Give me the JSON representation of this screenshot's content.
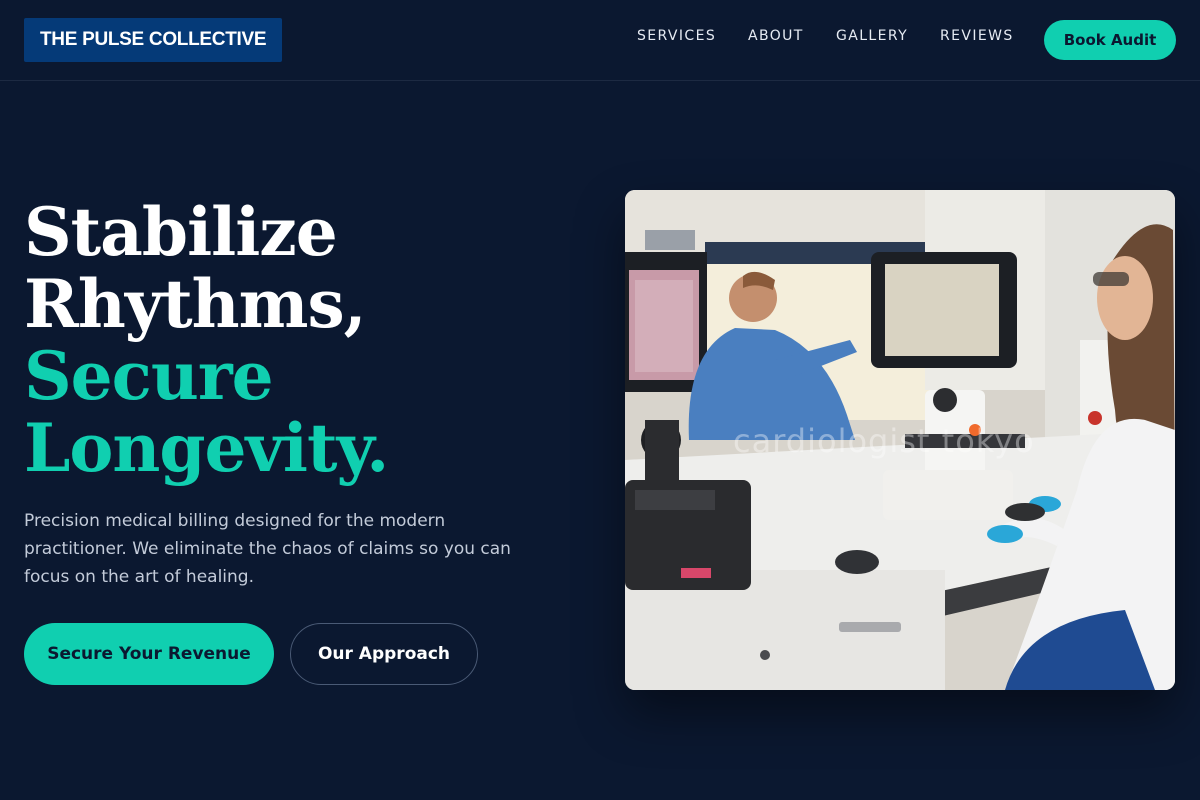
{
  "header": {
    "logo": "THE PULSE COLLECTIVE",
    "nav": [
      "SERVICES",
      "ABOUT",
      "GALLERY",
      "REVIEWS"
    ],
    "cta": "Book Audit"
  },
  "hero": {
    "headline": {
      "line1": "Stabilize",
      "line2": "Rhythms,",
      "line3": "Secure",
      "line4": "Longevity."
    },
    "lead": "Precision medical billing designed for the modern practitioner. We eliminate the chaos of claims so you can focus on the art of healing.",
    "primary_button": "Secure Your Revenue",
    "secondary_button": "Our Approach",
    "image_watermark": "cardiologist tokyo"
  },
  "colors": {
    "background": "#0b1830",
    "accent": "#10cfb0",
    "logo_bg": "#053a78"
  }
}
